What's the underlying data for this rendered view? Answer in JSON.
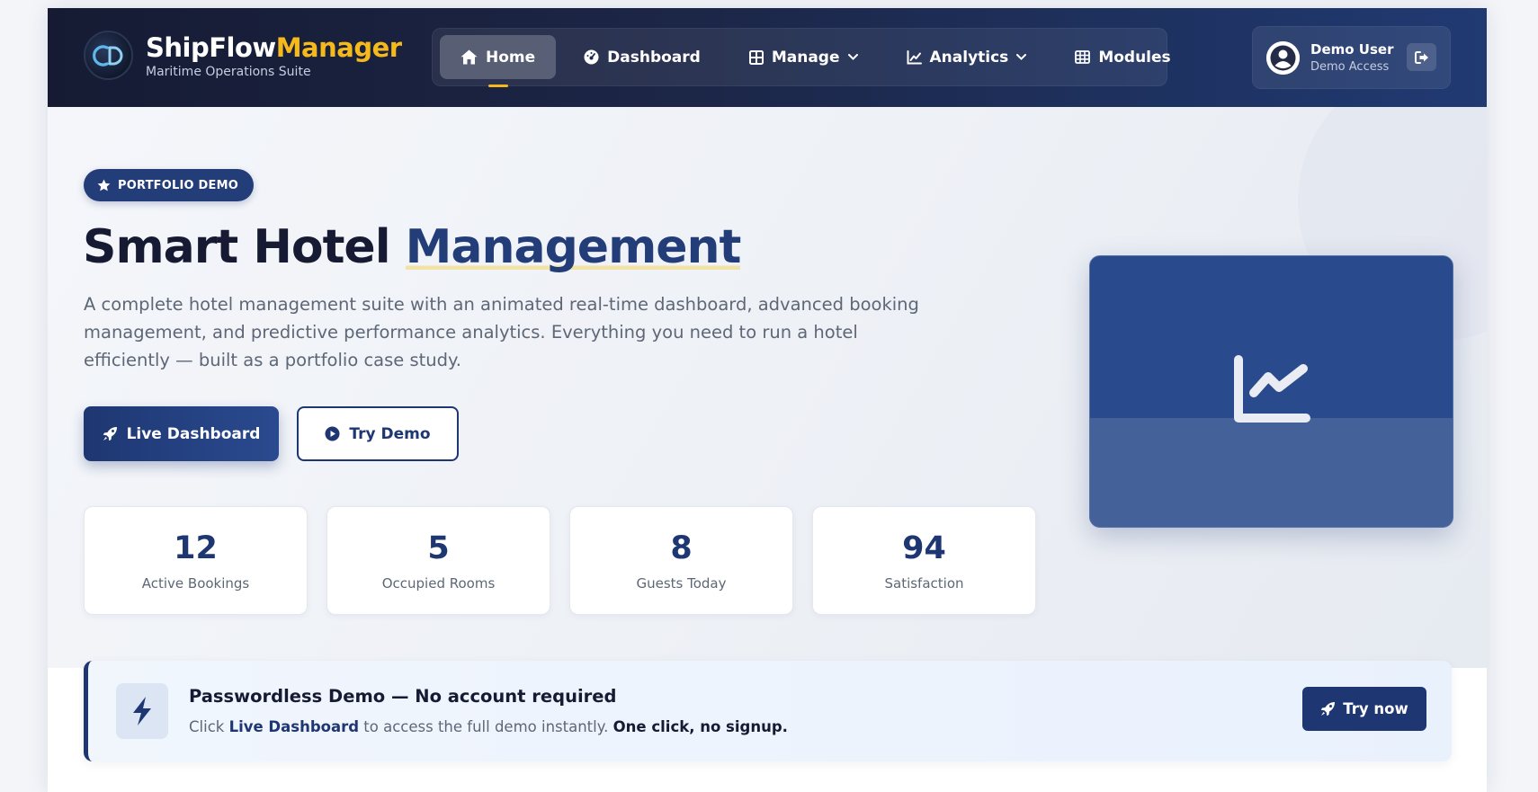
{
  "brand": {
    "name_main": "ShipFlow",
    "name_accent": "Manager",
    "subtitle": "Maritime Operations Suite"
  },
  "nav": {
    "items": [
      {
        "label": "Home",
        "icon": "home-icon",
        "active": true
      },
      {
        "label": "Dashboard",
        "icon": "gauge-icon"
      },
      {
        "label": "Manage",
        "icon": "grid-icon",
        "dropdown": true
      },
      {
        "label": "Analytics",
        "icon": "chart-line-icon",
        "dropdown": true
      },
      {
        "label": "Modules",
        "icon": "table-icon"
      }
    ]
  },
  "user": {
    "name": "Demo User",
    "role": "Demo Access"
  },
  "hero": {
    "badge": "PORTFOLIO DEMO",
    "title_main": "Smart Hotel ",
    "title_accent": "Management",
    "description": "A complete hotel management suite with an animated real-time dashboard, advanced booking management, and predictive performance analytics. Everything you need to run a hotel efficiently — built as a portfolio case study.",
    "primary_button": "Live Dashboard",
    "secondary_button": "Try Demo"
  },
  "stats": [
    {
      "value": "12",
      "label": "Active Bookings"
    },
    {
      "value": "5",
      "label": "Occupied Rooms"
    },
    {
      "value": "8",
      "label": "Guests Today"
    },
    {
      "value": "94",
      "label": "Satisfaction"
    }
  ],
  "callout": {
    "title": "Passwordless Demo — No account required",
    "body_prefix": "Click ",
    "body_link": "Live Dashboard",
    "body_middle": " to access the full demo instantly. ",
    "body_emphasis": "One click, no signup.",
    "button": "Try now"
  },
  "colors": {
    "navy": "#1e3772",
    "accent_yellow": "#f6b91c",
    "dark": "#161b33"
  }
}
